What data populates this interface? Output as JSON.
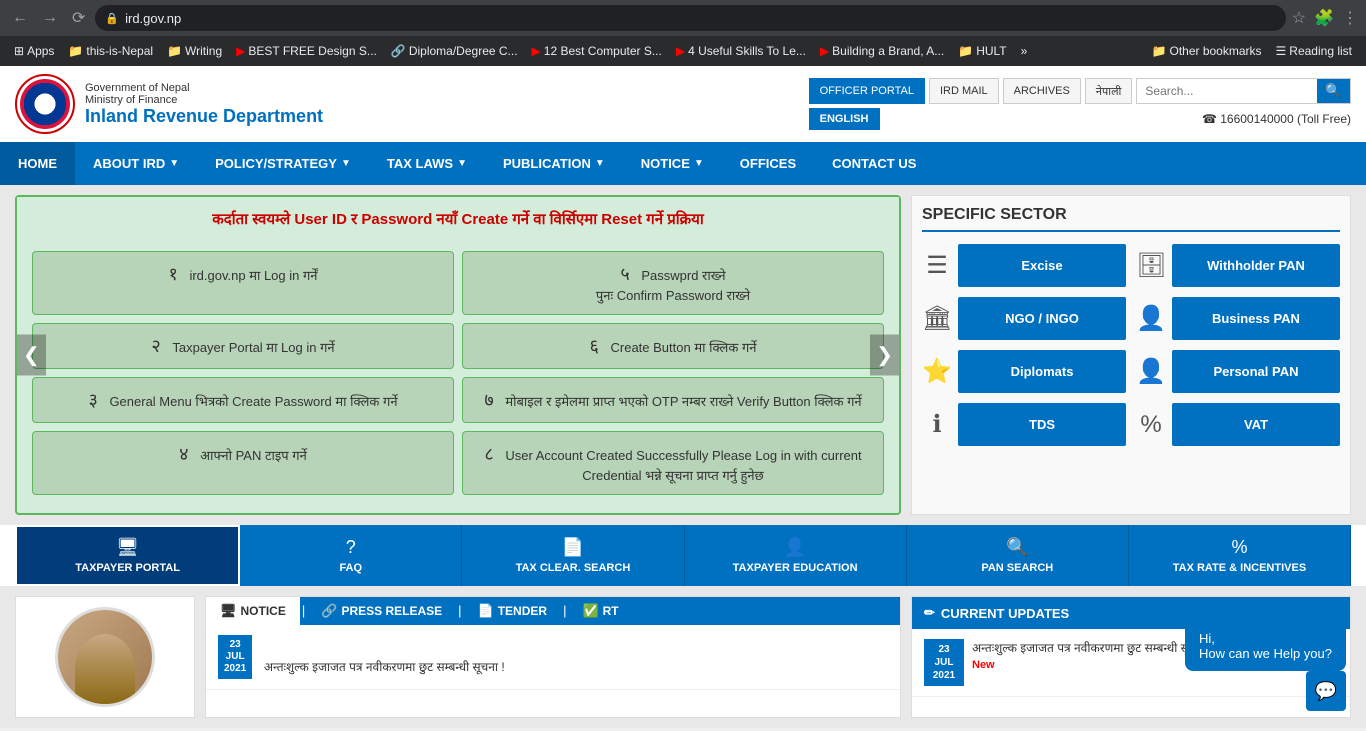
{
  "browser": {
    "url": "ird.gov.np",
    "back_title": "back",
    "forward_title": "forward",
    "reload_title": "reload"
  },
  "bookmarks": [
    {
      "id": "apps",
      "label": "Apps",
      "icon": "⊞",
      "type": "apps"
    },
    {
      "id": "this-is-nepal",
      "label": "this-is-Nepal",
      "icon": "📁",
      "type": "folder"
    },
    {
      "id": "writing",
      "label": "Writing",
      "icon": "📁",
      "type": "folder"
    },
    {
      "id": "best-free",
      "label": "BEST FREE Design S...",
      "icon": "▶",
      "type": "youtube"
    },
    {
      "id": "diploma",
      "label": "Diploma/Degree C...",
      "icon": "🔗",
      "type": "link"
    },
    {
      "id": "12best",
      "label": "12 Best Computer S...",
      "icon": "▶",
      "type": "youtube"
    },
    {
      "id": "4useful",
      "label": "4 Useful Skills To Le...",
      "icon": "▶",
      "type": "youtube"
    },
    {
      "id": "building",
      "label": "Building a Brand, A...",
      "icon": "▶",
      "type": "youtube"
    },
    {
      "id": "hult",
      "label": "HULT",
      "icon": "📁",
      "type": "folder"
    },
    {
      "id": "more",
      "label": "»",
      "icon": "",
      "type": "more"
    },
    {
      "id": "other",
      "label": "Other bookmarks",
      "icon": "📁",
      "type": "folder"
    },
    {
      "id": "reading-list",
      "label": "Reading list",
      "icon": "☰",
      "type": "reading"
    }
  ],
  "header": {
    "gov_label": "Government of Nepal",
    "ministry_label": "Ministry of Finance",
    "ird_label": "Inland Revenue Department",
    "officer_portal_btn": "OFFICER PORTAL",
    "ird_mail_btn": "IRD MAIL",
    "archives_btn": "ARCHIVES",
    "nepali_btn": "नेपाली",
    "english_btn": "ENGLISH",
    "search_placeholder": "Search...",
    "toll_free": "☎ 16600140000 (Toll Free)"
  },
  "nav": {
    "items": [
      {
        "id": "home",
        "label": "HOME",
        "has_arrow": false,
        "active": true
      },
      {
        "id": "about",
        "label": "ABOUT IRD",
        "has_arrow": true,
        "active": false
      },
      {
        "id": "policy",
        "label": "POLICY/STRATEGY",
        "has_arrow": true,
        "active": false
      },
      {
        "id": "tax-laws",
        "label": "TAX LAWS",
        "has_arrow": true,
        "active": false
      },
      {
        "id": "publication",
        "label": "PUBLICATION",
        "has_arrow": true,
        "active": false
      },
      {
        "id": "notice",
        "label": "NOTICE",
        "has_arrow": true,
        "active": false
      },
      {
        "id": "offices",
        "label": "OFFICES",
        "has_arrow": false,
        "active": false
      },
      {
        "id": "contact",
        "label": "CONTACT US",
        "has_arrow": false,
        "active": false
      }
    ]
  },
  "slider": {
    "header_text": "कर्दाता स्वयम्ले User ID र Password नयाँ Create गर्ने वा विर्सिएमा Reset गर्ने प्रक्रिया",
    "steps": [
      {
        "num": "१",
        "text": "ird.gov.np मा Log in गर्नें"
      },
      {
        "num": "५",
        "text": "Passwprd राख्ने\nपुनः Confirm Password राख्ने"
      },
      {
        "num": "२",
        "text": "Taxpayer Portal मा Log in गर्ने"
      },
      {
        "num": "६",
        "text": "Create Button मा क्लिक गर्ने"
      },
      {
        "num": "३",
        "text": "General Menu भित्रको\nCreate Password मा क्लिक गर्ने"
      },
      {
        "num": "७",
        "text": "मोबाइल र इमेलमा प्राप्त भएको OTP नम्बर\nराख्ने Verify Button क्लिक गर्ने"
      },
      {
        "num": "४",
        "text": "आफ्नो PAN टाइप गर्ने"
      },
      {
        "num": "८",
        "text": "User Account Created Successfully Please Log in with current Credential भन्ने सूचना प्राप्त गर्नु हुनेछ"
      }
    ]
  },
  "specific_sector": {
    "title": "SPECIFIC SECTOR",
    "items": [
      {
        "id": "excise",
        "label": "Excise",
        "icon": "☰"
      },
      {
        "id": "withholder-pan",
        "label": "Withholder PAN",
        "icon": "🗄"
      },
      {
        "id": "ngo-ingo",
        "label": "NGO / INGO",
        "icon": "🏛"
      },
      {
        "id": "business-pan",
        "label": "Business PAN",
        "icon": "👤"
      },
      {
        "id": "diplomats",
        "label": "Diplomats",
        "icon": "⭐"
      },
      {
        "id": "personal-pan",
        "label": "Personal PAN",
        "icon": "👤"
      },
      {
        "id": "tds",
        "label": "TDS",
        "icon": "ℹ"
      },
      {
        "id": "vat",
        "label": "VAT",
        "icon": "%"
      }
    ]
  },
  "bottom_tabs": [
    {
      "id": "taxpayer-portal",
      "label": "TAXPAYER PORTAL",
      "icon": "🖥",
      "active": true
    },
    {
      "id": "faq",
      "label": "FAQ",
      "icon": "?",
      "active": false
    },
    {
      "id": "tax-clear",
      "label": "TAX CLEAR. SEARCH",
      "icon": "📄",
      "active": false
    },
    {
      "id": "taxpayer-edu",
      "label": "TAXPAYER EDUCATION",
      "icon": "👤",
      "active": false
    },
    {
      "id": "pan-search",
      "label": "PAN SEARCH",
      "icon": "🔍",
      "active": false
    },
    {
      "id": "tax-rate",
      "label": "TAX RATE & INCENTIVES",
      "icon": "%",
      "active": false
    }
  ],
  "news": {
    "tabs": [
      {
        "id": "notice",
        "label": "NOTICE",
        "active": true,
        "icon": "🖥"
      },
      {
        "id": "press-release",
        "label": "PRESS RELEASE",
        "active": false,
        "icon": "🔗"
      },
      {
        "id": "tender",
        "label": "TENDER",
        "active": false,
        "icon": "📄"
      },
      {
        "id": "rt",
        "label": "RT",
        "active": false,
        "icon": "✅"
      }
    ],
    "items": [
      {
        "date_day": "23",
        "date_month": "JUL",
        "date_year": "2021",
        "text": "अन्तःशुल्क इजाजत पत्र नवीकरणमा छुट सम्बन्धी सूचना !"
      }
    ]
  },
  "current_updates": {
    "title": "CURRENT UPDATES",
    "items": [
      {
        "date_day": "23",
        "date_month": "JUL",
        "date_year": "2021",
        "text": "अन्तःशुल्क इजाजत पत्र नवीकरणमा छुट सम्बन्धी सूचना !",
        "is_new": true,
        "new_label": "New"
      }
    ]
  },
  "chat": {
    "greeting": "Hi,",
    "message": "How can we Help you?",
    "btn_icon": "💬"
  }
}
